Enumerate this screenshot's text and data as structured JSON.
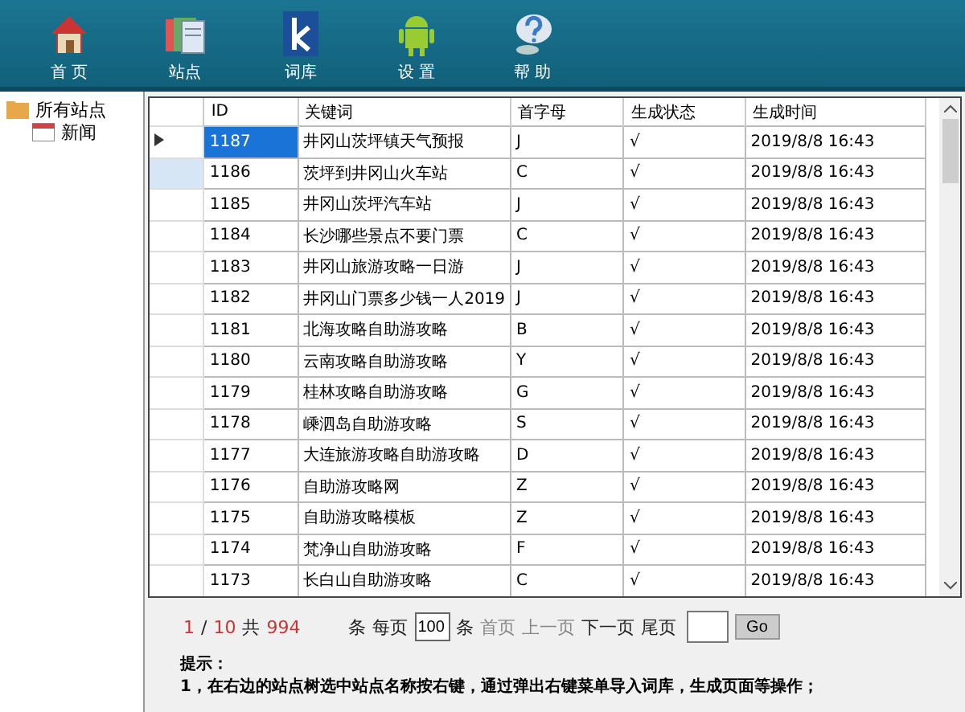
{
  "toolbar": [
    {
      "label": "首 页",
      "kind": "house"
    },
    {
      "label": "站点",
      "kind": "pages"
    },
    {
      "label": "词库",
      "kind": "k"
    },
    {
      "label": "设 置",
      "kind": "robot"
    },
    {
      "label": "帮 助",
      "kind": "help"
    }
  ],
  "tree": {
    "label": "所有站点",
    "children": [
      {
        "label": "新闻"
      }
    ]
  },
  "table": {
    "columns": [
      "ID",
      "关键词",
      "首字母",
      "生成状态",
      "生成时间"
    ],
    "rows": [
      {
        "id": "1187",
        "keyword": "井冈山茨坪镇天气预报",
        "initial": "J",
        "status": "√",
        "time": "2019/8/8 16:43",
        "selected": true,
        "current": false
      },
      {
        "id": "1186",
        "keyword": "茨坪到井冈山火车站",
        "initial": "C",
        "status": "√",
        "time": "2019/8/8 16:43",
        "selected": false,
        "current": true
      },
      {
        "id": "1185",
        "keyword": "井冈山茨坪汽车站",
        "initial": "J",
        "status": "√",
        "time": "2019/8/8 16:43",
        "selected": false,
        "current": false
      },
      {
        "id": "1184",
        "keyword": "长沙哪些景点不要门票",
        "initial": "C",
        "status": "√",
        "time": "2019/8/8 16:43",
        "selected": false,
        "current": false
      },
      {
        "id": "1183",
        "keyword": "井冈山旅游攻略一日游",
        "initial": "J",
        "status": "√",
        "time": "2019/8/8 16:43",
        "selected": false,
        "current": false
      },
      {
        "id": "1182",
        "keyword": "井冈山门票多少钱一人2019",
        "initial": "J",
        "status": "√",
        "time": "2019/8/8 16:43",
        "selected": false,
        "current": false
      },
      {
        "id": "1181",
        "keyword": "北海攻略自助游攻略",
        "initial": "B",
        "status": "√",
        "time": "2019/8/8 16:43",
        "selected": false,
        "current": false
      },
      {
        "id": "1180",
        "keyword": "云南攻略自助游攻略",
        "initial": "Y",
        "status": "√",
        "time": "2019/8/8 16:43",
        "selected": false,
        "current": false
      },
      {
        "id": "1179",
        "keyword": "桂林攻略自助游攻略",
        "initial": "G",
        "status": "√",
        "time": "2019/8/8 16:43",
        "selected": false,
        "current": false
      },
      {
        "id": "1178",
        "keyword": "嵊泗岛自助游攻略",
        "initial": "S",
        "status": "√",
        "time": "2019/8/8 16:43",
        "selected": false,
        "current": false
      },
      {
        "id": "1177",
        "keyword": "大连旅游攻略自助游攻略",
        "initial": "D",
        "status": "√",
        "time": "2019/8/8 16:43",
        "selected": false,
        "current": false
      },
      {
        "id": "1176",
        "keyword": "自助游攻略网",
        "initial": "Z",
        "status": "√",
        "time": "2019/8/8 16:43",
        "selected": false,
        "current": false
      },
      {
        "id": "1175",
        "keyword": "自助游攻略模板",
        "initial": "Z",
        "status": "√",
        "time": "2019/8/8 16:43",
        "selected": false,
        "current": false
      },
      {
        "id": "1174",
        "keyword": "梵净山自助游攻略",
        "initial": "F",
        "status": "√",
        "time": "2019/8/8 16:43",
        "selected": false,
        "current": false
      },
      {
        "id": "1173",
        "keyword": "长白山自助游攻略",
        "initial": "C",
        "status": "√",
        "time": "2019/8/8 16:43",
        "selected": false,
        "current": false
      }
    ]
  },
  "pager": {
    "page": "1",
    "separator": "/",
    "pages": "10",
    "total_label": "共",
    "total": "994",
    "unit": "条",
    "per_page_label": "每页",
    "per_page": "100",
    "per_page_unit": "条",
    "links": [
      {
        "label": "首页",
        "disabled": true
      },
      {
        "label": "上一页",
        "disabled": true
      },
      {
        "label": "下一页",
        "disabled": false
      },
      {
        "label": "尾页",
        "disabled": false
      }
    ],
    "go": "Go"
  },
  "tips": {
    "title": "提示：",
    "lines": [
      "1，在右边的站点树选中站点名称按右键，通过弹出右键菜单导入词库，生成页面等操作；"
    ]
  }
}
